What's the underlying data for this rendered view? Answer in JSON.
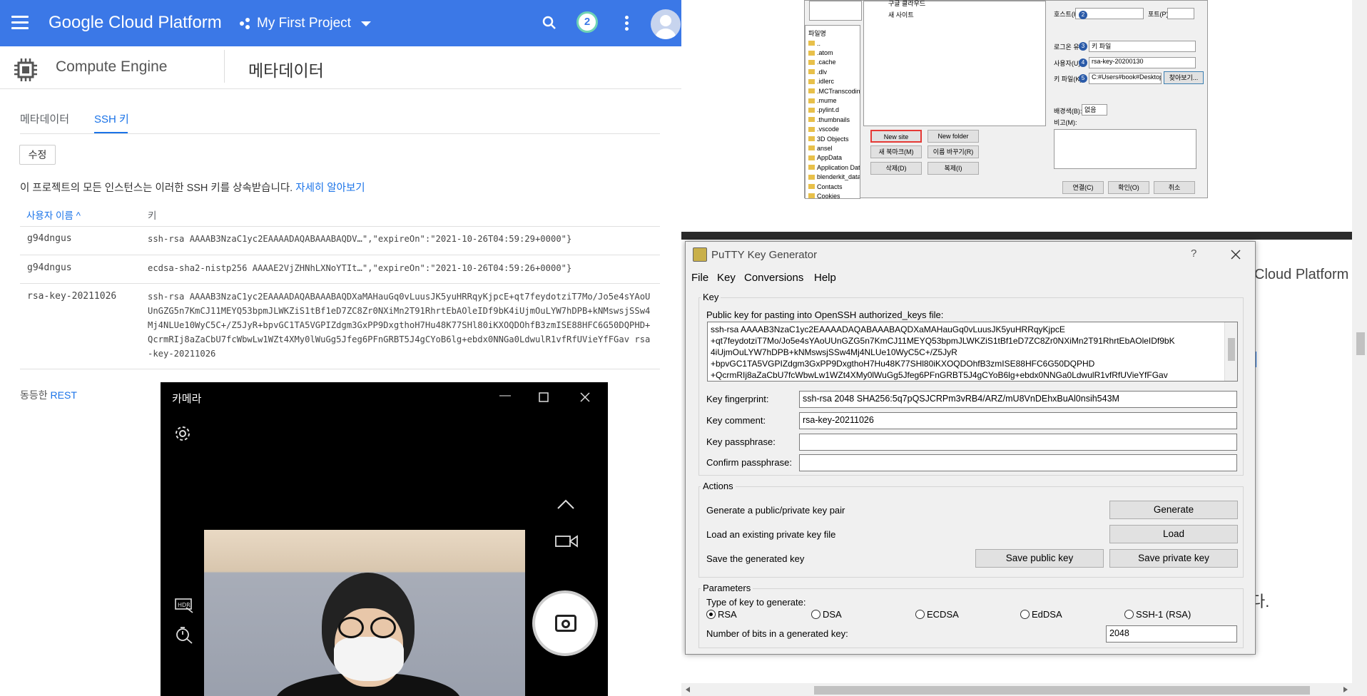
{
  "gcp": {
    "brand": "Google Cloud Platform",
    "project": "My First Project",
    "notification_count": "2",
    "section": "Compute Engine",
    "page_title": "메타데이터",
    "tabs": [
      "메타데이터",
      "SSH 키"
    ],
    "edit_label": "수정",
    "info_text": "이 프로젝트의 모든 인스턴스는 이러한 SSH 키를 상속받습니다.",
    "info_link": "자세히 알아보기",
    "col_user": "사용자 이름 ^",
    "col_key": "키",
    "rows": [
      {
        "user": "g94dngus",
        "key": "ssh-rsa AAAAB3NzaC1yc2EAAAADAQABAAABAQDV…\",\"expireOn\":\"2021-10-26T04:59:29+0000\"}"
      },
      {
        "user": "g94dngus",
        "key": "ecdsa-sha2-nistp256 AAAAE2VjZHNhLXNoYTIt…\",\"expireOn\":\"2021-10-26T04:59:26+0000\"}"
      },
      {
        "user": "rsa-key-20211026",
        "key": "ssh-rsa AAAAB3NzaC1yc2EAAAADAQABAAABAQDXaMAHauGq0vLuusJK5yuHRRqyKjpcE+qt7feydotziT7Mo/Jo5e4sYAoUUnGZG5n7KmCJ11MEYQ53bpmJLWKZiS1tBf1eD7ZC8Zr0NXiMn2T91RhrtEbAOleIDf9bK4iUjmOuLYW7hDPB+kNMswsjSSw4Mj4NLUe10WyC5C+/Z5JyR+bpvGC1TA5VGPIZdgm3GxPP9DxgthoH7Hu48K77SHl80iKXOQDOhfB3zmISE88HFC6G50DQPHD+QcrmRIj8aZaCbU7fcWbwLw1WZt4XMy0lWuGg5Jfeg6PFnGRBT5J4gCYoB6lg+ebdx0NNGa0LdwulR1vfRfUVieYfFGav rsa-key-20211026"
      }
    ],
    "rest_text": "동등한",
    "rest_link": "REST"
  },
  "camera": {
    "title": "카메라"
  },
  "filezilla": {
    "tree": [
      "구글 클라우드",
      "새 사이트"
    ],
    "file_header": "파일명",
    "files": [
      "..",
      ".atom",
      ".cache",
      ".dlv",
      ".idlerc",
      ".MCTranscoding",
      ".mume",
      ".pylint.d",
      ".thumbnails",
      ".vscode",
      "3D Objects",
      "ansel",
      "AppData",
      "Application Data",
      "blenderkit_data",
      "Contacts",
      "Cookies"
    ],
    "host_label": "호스트(H):",
    "port_label": "포트(P):",
    "logon_label": "로그온 유형",
    "logon_value": "키 파일",
    "user_label": "사용자(U):",
    "user_value": "rsa-key-20200130",
    "keyfile_label": "키 파일(K):",
    "keyfile_value": "C:#Users#book#Desktop",
    "browse": "찾아보기...",
    "bg_label": "배경색(B):",
    "bg_value": "없음",
    "comment_label": "비고(M):",
    "btn_new_site": "New site",
    "btn_new_folder": "New folder",
    "btn_bookmark": "새 북마크(M)",
    "btn_rename": "이름 바꾸기(R)",
    "btn_delete": "삭제(D)",
    "btn_copy": "복제(I)",
    "btn_connect": "연결(C)",
    "btn_ok": "확인(O)",
    "btn_cancel": "취소",
    "badges": [
      "2",
      "3",
      "4",
      "5"
    ]
  },
  "putty": {
    "title": "PuTTY Key Generator",
    "help": "?",
    "menu": [
      "File",
      "Key",
      "Conversions",
      "Help"
    ],
    "key_group": "Key",
    "pubkey_label": "Public key for pasting into OpenSSH authorized_keys file:",
    "pubkey_lines": [
      "ssh-rsa AAAAB3NzaC1yc2EAAAADAQABAAABAQDXaMAHauGq0vLuusJK5yuHRRqyKjpcE",
      "+qt7feydotziT7Mo/Jo5e4sYAoUUnGZG5n7KmCJ11MEYQ53bpmJLWKZiS1tBf1eD7ZC8Zr0NXiMn2T91RhrtEbAOleIDf9bK",
      "4iUjmOuLYW7hDPB+kNMswsjSSw4Mj4NLUe10WyC5C+/Z5JyR",
      "+bpvGC1TA5VGPIZdgm3GxPP9DxgthoH7Hu48K77SHl80iKXOQDOhfB3zmISE88HFC6G50DQPHD",
      "+QcrmRIj8aZaCbU7fcWbwLw1WZt4XMy0lWuGg5Jfeg6PFnGRBT5J4gCYoB6lg+ebdx0NNGa0LdwulR1vfRfUVieYfFGav"
    ],
    "fp_label": "Key fingerprint:",
    "fp_value": "ssh-rsa 2048 SHA256:5q7pQSJCRPm3vRB4/ARZ/mU8VnDEhxBuAl0nsih543M",
    "comment_label": "Key comment:",
    "comment_value": "rsa-key-20211026",
    "pass_label": "Key passphrase:",
    "confirm_label": "Confirm passphrase:",
    "actions_group": "Actions",
    "gen_text": "Generate a public/private key pair",
    "gen_btn": "Generate",
    "load_text": "Load an existing private key file",
    "load_btn": "Load",
    "save_text": "Save the generated key",
    "save_pub_btn": "Save public key",
    "save_priv_btn": "Save private key",
    "params_group": "Parameters",
    "type_label": "Type of key to generate:",
    "types": [
      "RSA",
      "DSA",
      "ECDSA",
      "EdDSA",
      "SSH-1 (RSA)"
    ],
    "selected_type": "RSA",
    "bits_label": "Number of bits in a generated key:",
    "bits_value": "2048"
  },
  "background": {
    "gcp_text": "Cloud Platform",
    "korean_fragment": "다."
  }
}
